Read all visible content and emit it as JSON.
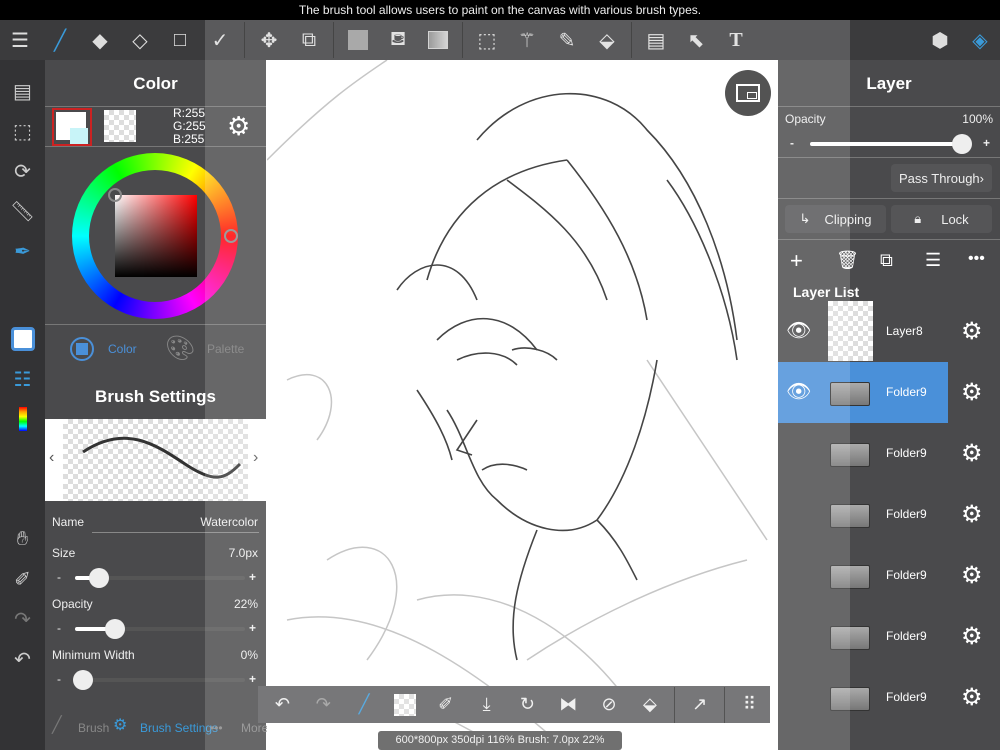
{
  "tooltip": "The brush tool allows users to paint on the canvas with various brush types.",
  "toolbar": {
    "icons": [
      "menu-icon",
      "brush-icon",
      "eraser-icon",
      "blur-eraser-icon",
      "rectangle-icon",
      "vector-icon",
      "move-icon",
      "transform-icon",
      "fill-color-icon",
      "bucket-icon",
      "gradient-icon",
      "selection-icon",
      "magic-wand-icon",
      "select-pen-icon",
      "select-eraser-icon",
      "frame-divider-icon",
      "select-move-icon",
      "text-icon",
      "materials-icon",
      "layers-icon"
    ],
    "text_glyph": "T"
  },
  "color": {
    "title": "Color",
    "r": "R:255",
    "g": "G:255",
    "b": "B:255",
    "tab_color": "Color",
    "tab_palette": "Palette",
    "accent": "#4a90d9"
  },
  "brush": {
    "title": "Brush Settings",
    "name_label": "Name",
    "name_value": "Watercolor",
    "size_label": "Size",
    "size_value": "7.0px",
    "size_level": 0.15,
    "opacity_label": "Opacity",
    "opacity_value": "22%",
    "opacity_level": 0.22,
    "minwidth_label": "Minimum Width",
    "minwidth_value": "0%",
    "minwidth_level": 0,
    "minus": "-",
    "plus": "+",
    "tab_brush": "Brush",
    "tab_settings": "Brush Settings",
    "tab_more": "More"
  },
  "layer": {
    "title": "Layer",
    "opacity_label": "Opacity",
    "opacity_value": "100%",
    "opacity_level": 1,
    "blend_mode": "Pass Through",
    "clipping": "Clipping",
    "lock": "Lock",
    "list_title": "Layer List",
    "layers": [
      {
        "name": "Layer8",
        "type": "layer",
        "selected": false
      },
      {
        "name": "Folder9",
        "type": "folder",
        "selected": true
      },
      {
        "name": "Folder9",
        "type": "folder",
        "selected": false
      },
      {
        "name": "Folder9",
        "type": "folder",
        "selected": false
      },
      {
        "name": "Folder9",
        "type": "folder",
        "selected": false
      },
      {
        "name": "Folder9",
        "type": "folder",
        "selected": false
      },
      {
        "name": "Folder9",
        "type": "folder",
        "selected": false
      }
    ]
  },
  "status": "600*800px 350dpi 116% Brush: 7.0px 22%"
}
